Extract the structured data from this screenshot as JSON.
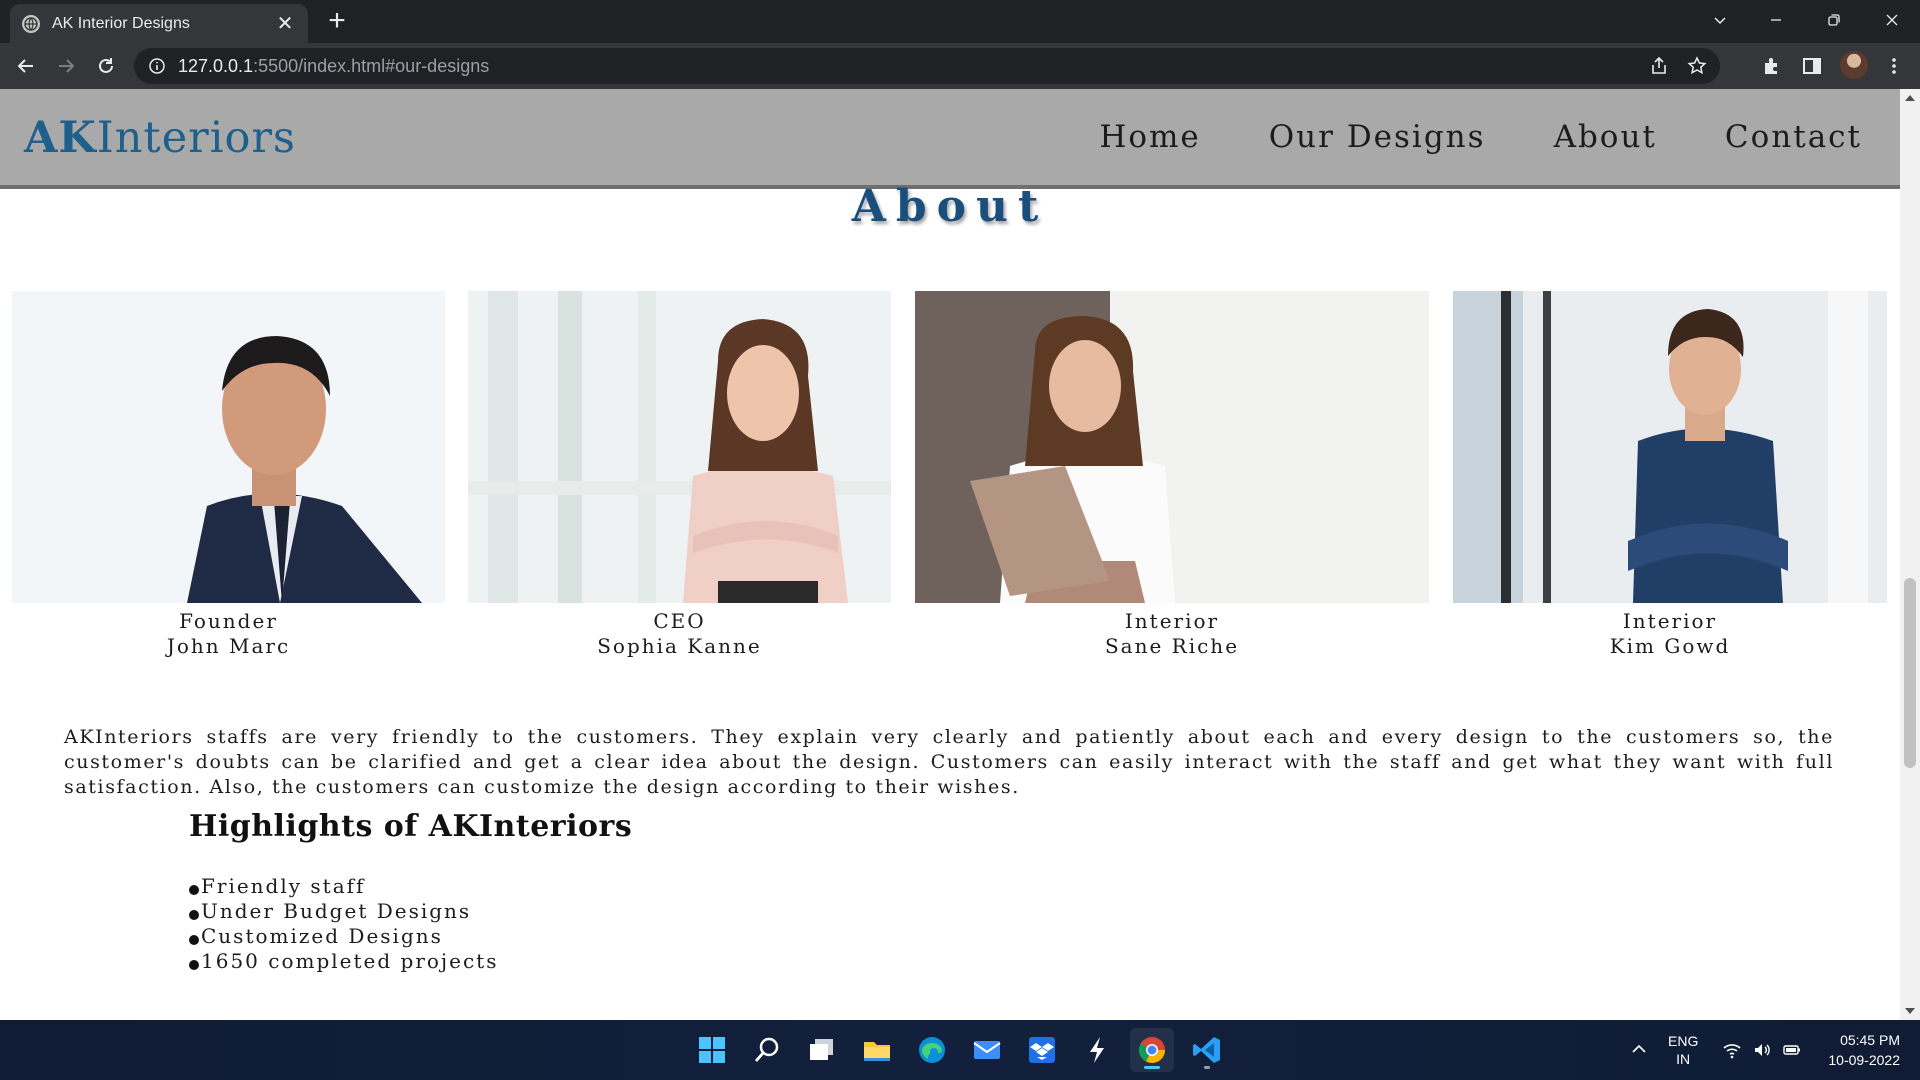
{
  "browser": {
    "tab_title": "AK Interior Designs",
    "url_host": "127.0.0.1",
    "url_rest": ":5500/index.html#our-designs"
  },
  "site": {
    "logo_bold": "AK",
    "logo_rest": "Interiors",
    "nav": [
      "Home",
      "Our Designs",
      "About",
      "Contact"
    ],
    "section_title": "About"
  },
  "team": [
    {
      "role": "Founder",
      "name": "John Marc"
    },
    {
      "role": "CEO",
      "name": "Sophia Kanne"
    },
    {
      "role": "Interior",
      "name": "Sane Riche"
    },
    {
      "role": "Interior",
      "name": "Kim Gowd"
    }
  ],
  "about_text": "AKInteriors staffs are very friendly to the customers. They explain very clearly and patiently about each and every design to the customers so, the customer's doubts can be clarified and get a clear idea about the design. Customers can easily interact with the staff and get what they want with full satisfaction. Also, the customers can customize the design according to their wishes.",
  "highlights": {
    "title": "Highlights of AKInteriors",
    "items": [
      "Friendly staff",
      "Under Budget Designs",
      "Customized Designs",
      "1650 completed projects"
    ]
  },
  "taskbar": {
    "lang_top": "ENG",
    "lang_bottom": "IN",
    "time": "05:45 PM",
    "date": "10-09-2022",
    "apps": [
      "start-icon",
      "search-icon",
      "task-view-icon",
      "file-explorer-icon",
      "edge-icon",
      "mail-icon",
      "dropbox-icon",
      "bolt-app-icon",
      "chrome-icon",
      "vscode-icon"
    ]
  },
  "colors": {
    "brand_blue": "#1f5f8b",
    "header_grey": "#a9a9a9",
    "title_blue": "#1a4f7d"
  }
}
